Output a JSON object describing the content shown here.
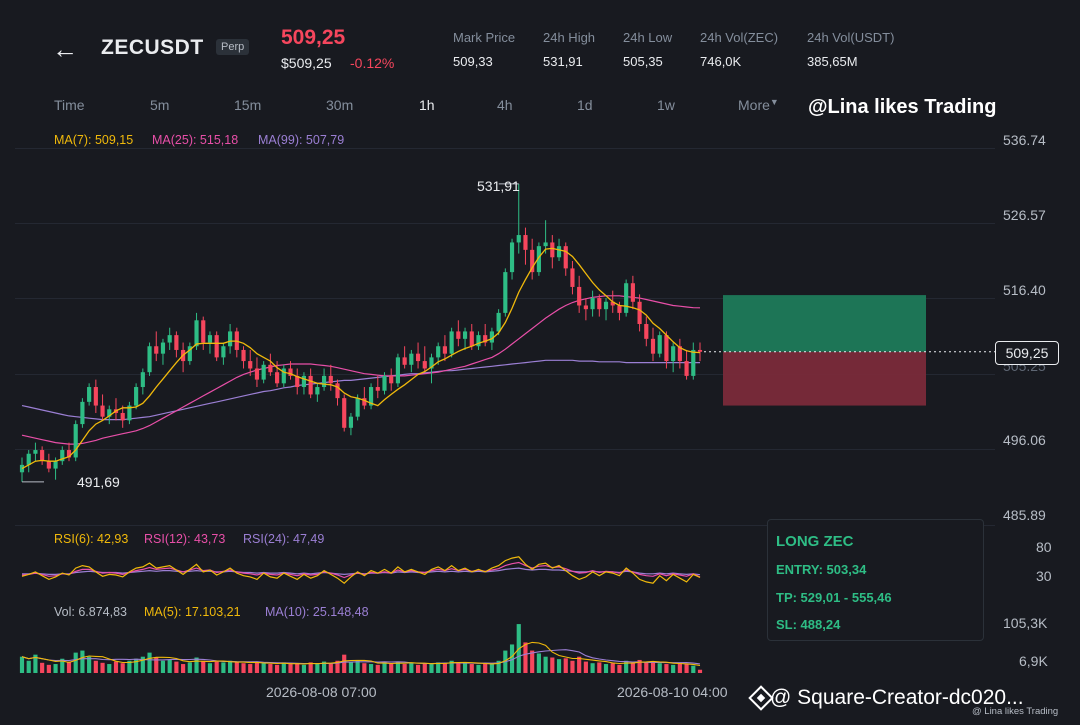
{
  "header": {
    "back_icon": "arrow-left-icon",
    "symbol": "ZECUSDT",
    "badge": "Perp",
    "last_price": "509,25",
    "last_price_usd": "$509,25",
    "change_pct": "-0.12%",
    "stats": [
      {
        "label": "Mark Price",
        "value": "509,33"
      },
      {
        "label": "24h High",
        "value": "531,91"
      },
      {
        "label": "24h Low",
        "value": "505,35"
      },
      {
        "label": "24h Vol(ZEC)",
        "value": "746,0K"
      },
      {
        "label": "24h Vol(USDT)",
        "value": "385,65M"
      }
    ]
  },
  "timeframes": [
    "Time",
    "5m",
    "15m",
    "30m",
    "1h",
    "4h",
    "1d",
    "1w",
    "More"
  ],
  "active_timeframe": "1h",
  "watermark": "@Lina likes Trading",
  "ma_legend": {
    "ma7": "MA(7): 509,15",
    "ma25": "MA(25): 515,18",
    "ma99": "MA(99): 507,79"
  },
  "rsi_legend": {
    "rsi6": "RSI(6): 42,93",
    "rsi12": "RSI(12): 43,73",
    "rsi24": "RSI(24): 47,49"
  },
  "vol_legend": {
    "vol": "Vol: 6.874,83",
    "ma5": "MA(5): 17.103,21",
    "ma10": "MA(10): 25.148,48"
  },
  "colors": {
    "up": "#2ebd85",
    "down": "#f6465d",
    "ma7": "#f0b90b",
    "ma25": "#e84fa8",
    "ma99": "#9b7fd4",
    "bg": "#181a20"
  },
  "signal": {
    "title": "LONG ZEC",
    "entry": "ENTRY: 503,34",
    "tp": "TP: 529,01 - 555,46",
    "sl": "SL: 488,24"
  },
  "footer": {
    "tag": "@ Square-Creator-dc020...",
    "small": "@ Lina likes Trading",
    "logo_icon": "binance-diamond-icon"
  },
  "chart_data": {
    "type": "candlestick",
    "y_ticks": [
      "536.74",
      "526.57",
      "516.40",
      "505.25",
      "496.06",
      "485.89"
    ],
    "ylim": [
      485.89,
      536.74
    ],
    "current_price_tag": "509,25",
    "high_label": "531,91",
    "low_label": "491,69",
    "x_labels": [
      "2026-08-08 07:00",
      "2026-08-10 04:00"
    ],
    "rsi_ticks": [
      "80",
      "30"
    ],
    "vol_ticks": [
      "105,3K",
      "6,9K"
    ],
    "candles": [
      [
        493.0,
        495.0,
        491.7,
        494.0
      ],
      [
        494.0,
        496.0,
        493.0,
        495.5
      ],
      [
        495.5,
        497.0,
        494.5,
        496.0
      ],
      [
        496.0,
        496.5,
        494.0,
        494.5
      ],
      [
        494.5,
        495.5,
        493.0,
        493.5
      ],
      [
        493.5,
        495.0,
        492.0,
        494.5
      ],
      [
        494.5,
        496.5,
        494.0,
        496.0
      ],
      [
        496.0,
        497.0,
        494.5,
        495.0
      ],
      [
        495.0,
        500.0,
        494.5,
        499.5
      ],
      [
        499.5,
        503.0,
        499.0,
        502.5
      ],
      [
        502.5,
        505.0,
        502.0,
        504.5
      ],
      [
        504.5,
        505.5,
        501.0,
        502.0
      ],
      [
        502.0,
        503.5,
        500.0,
        500.5
      ],
      [
        500.5,
        502.0,
        499.5,
        501.5
      ],
      [
        501.5,
        503.0,
        500.0,
        501.0
      ],
      [
        501.0,
        502.0,
        499.0,
        500.0
      ],
      [
        500.0,
        502.5,
        499.5,
        502.0
      ],
      [
        502.0,
        505.0,
        501.5,
        504.5
      ],
      [
        504.5,
        507.0,
        503.5,
        506.5
      ],
      [
        506.5,
        510.5,
        506.0,
        510.0
      ],
      [
        510.0,
        512.0,
        508.0,
        509.0
      ],
      [
        509.0,
        511.0,
        507.5,
        510.5
      ],
      [
        510.5,
        512.5,
        509.5,
        511.5
      ],
      [
        511.5,
        512.0,
        508.5,
        509.5
      ],
      [
        509.5,
        510.5,
        506.5,
        508.0
      ],
      [
        508.0,
        510.5,
        507.5,
        510.0
      ],
      [
        510.0,
        514.5,
        509.5,
        513.5
      ],
      [
        513.5,
        514.0,
        509.5,
        510.5
      ],
      [
        510.5,
        512.0,
        509.0,
        511.5
      ],
      [
        511.5,
        512.0,
        508.0,
        508.5
      ],
      [
        508.5,
        510.5,
        507.5,
        510.0
      ],
      [
        510.0,
        513.0,
        509.0,
        512.0
      ],
      [
        512.0,
        512.5,
        508.5,
        509.5
      ],
      [
        509.5,
        510.0,
        507.0,
        508.0
      ],
      [
        508.0,
        509.5,
        506.0,
        507.0
      ],
      [
        507.0,
        508.5,
        504.5,
        505.5
      ],
      [
        505.5,
        508.0,
        505.0,
        507.5
      ],
      [
        507.5,
        509.0,
        506.0,
        506.5
      ],
      [
        506.5,
        508.0,
        504.5,
        505.0
      ],
      [
        505.0,
        507.5,
        504.5,
        507.0
      ],
      [
        507.0,
        508.0,
        505.5,
        506.0
      ],
      [
        506.0,
        507.0,
        503.5,
        504.5
      ],
      [
        504.5,
        506.5,
        503.5,
        506.0
      ],
      [
        506.0,
        507.0,
        503.0,
        503.5
      ],
      [
        503.5,
        505.0,
        502.5,
        504.5
      ],
      [
        504.5,
        507.0,
        504.0,
        506.0
      ],
      [
        506.0,
        507.5,
        504.0,
        505.0
      ],
      [
        505.0,
        505.5,
        502.0,
        503.0
      ],
      [
        503.0,
        503.5,
        498.5,
        499.0
      ],
      [
        499.0,
        501.0,
        498.0,
        500.5
      ],
      [
        500.5,
        503.5,
        500.0,
        503.0
      ],
      [
        503.0,
        504.5,
        501.5,
        502.0
      ],
      [
        502.0,
        505.0,
        501.5,
        504.5
      ],
      [
        504.5,
        506.0,
        503.0,
        504.0
      ],
      [
        504.0,
        506.5,
        503.5,
        506.0
      ],
      [
        506.0,
        507.0,
        504.0,
        505.0
      ],
      [
        505.0,
        509.0,
        504.5,
        508.5
      ],
      [
        508.5,
        510.0,
        507.0,
        507.5
      ],
      [
        507.5,
        509.5,
        506.5,
        509.0
      ],
      [
        509.0,
        510.5,
        507.0,
        508.0
      ],
      [
        508.0,
        510.0,
        506.5,
        507.0
      ],
      [
        507.0,
        509.0,
        505.0,
        508.5
      ],
      [
        508.5,
        510.5,
        507.5,
        510.0
      ],
      [
        510.0,
        511.5,
        508.0,
        509.0
      ],
      [
        509.0,
        512.5,
        508.5,
        512.0
      ],
      [
        512.0,
        513.5,
        510.0,
        511.0
      ],
      [
        511.0,
        512.5,
        509.5,
        512.0
      ],
      [
        512.0,
        513.0,
        509.5,
        510.0
      ],
      [
        510.0,
        512.0,
        509.5,
        511.5
      ],
      [
        511.5,
        513.0,
        510.0,
        510.5
      ],
      [
        510.5,
        512.5,
        509.5,
        512.0
      ],
      [
        512.0,
        515.0,
        511.5,
        514.5
      ],
      [
        514.5,
        520.5,
        514.0,
        520.0
      ],
      [
        520.0,
        524.5,
        519.0,
        524.0
      ],
      [
        524.0,
        531.9,
        522.5,
        525.0
      ],
      [
        525.0,
        526.0,
        521.0,
        523.0
      ],
      [
        523.0,
        524.5,
        519.0,
        520.0
      ],
      [
        520.0,
        524.0,
        519.5,
        523.5
      ],
      [
        523.5,
        527.0,
        522.5,
        524.0
      ],
      [
        524.0,
        525.0,
        520.5,
        522.0
      ],
      [
        522.0,
        524.5,
        521.5,
        523.5
      ],
      [
        523.5,
        524.0,
        519.5,
        520.5
      ],
      [
        520.5,
        521.5,
        517.0,
        518.0
      ],
      [
        518.0,
        519.5,
        514.5,
        515.5
      ],
      [
        515.5,
        516.5,
        513.5,
        515.0
      ],
      [
        515.0,
        517.5,
        514.0,
        516.5
      ],
      [
        516.5,
        517.0,
        514.0,
        515.0
      ],
      [
        515.0,
        516.5,
        513.5,
        516.0
      ],
      [
        516.0,
        517.5,
        514.5,
        515.5
      ],
      [
        515.5,
        516.0,
        513.5,
        514.5
      ],
      [
        514.5,
        519.0,
        514.0,
        518.5
      ],
      [
        518.5,
        519.5,
        515.0,
        516.0
      ],
      [
        516.0,
        517.0,
        512.0,
        513.0
      ],
      [
        513.0,
        514.0,
        510.0,
        511.0
      ],
      [
        511.0,
        512.5,
        508.0,
        509.0
      ],
      [
        509.0,
        512.0,
        508.5,
        511.5
      ],
      [
        511.5,
        512.0,
        507.0,
        508.0
      ],
      [
        508.0,
        510.5,
        506.5,
        510.0
      ],
      [
        510.0,
        511.0,
        507.0,
        508.0
      ],
      [
        508.0,
        509.5,
        505.5,
        506.0
      ],
      [
        506.0,
        510.5,
        505.5,
        509.5
      ],
      [
        509.5,
        510.5,
        508.0,
        509.25
      ]
    ],
    "ma7": [
      493.5,
      494.0,
      494.5,
      494.6,
      494.5,
      494.5,
      494.8,
      495.1,
      496.0,
      497.3,
      498.6,
      499.5,
      500.0,
      500.6,
      501.3,
      501.7,
      501.7,
      501.8,
      502.3,
      503.3,
      504.5,
      505.6,
      506.7,
      507.8,
      508.8,
      509.5,
      510.3,
      510.4,
      510.4,
      510.4,
      510.4,
      510.7,
      510.7,
      510.4,
      509.8,
      509.0,
      508.5,
      508.0,
      507.1,
      506.5,
      506.3,
      505.9,
      505.6,
      505.3,
      505.0,
      504.9,
      504.8,
      504.5,
      503.7,
      503.2,
      503.0,
      502.7,
      502.3,
      502.0,
      502.8,
      503.5,
      504.2,
      504.8,
      505.5,
      506.2,
      506.6,
      507.2,
      507.9,
      508.3,
      508.8,
      509.3,
      509.7,
      510.0,
      510.4,
      510.7,
      511.0,
      511.8,
      513.2,
      515.1,
      517.3,
      519.0,
      520.6,
      522.0,
      523.1,
      523.2,
      523.0,
      522.8,
      522.1,
      521.0,
      519.8,
      518.6,
      517.6,
      516.8,
      516.0,
      515.5,
      515.4,
      515.2,
      514.9,
      514.2,
      513.1,
      512.4,
      511.5,
      510.6,
      509.8,
      509.4,
      509.2,
      509.15
    ],
    "ma25": [
      498.0,
      497.8,
      497.6,
      497.4,
      497.2,
      497.0,
      496.9,
      496.8,
      496.8,
      496.9,
      497.1,
      497.3,
      497.6,
      497.8,
      498.0,
      498.2,
      498.4,
      498.6,
      498.9,
      499.3,
      499.8,
      500.3,
      500.8,
      501.3,
      501.8,
      502.3,
      502.8,
      503.3,
      503.8,
      504.3,
      504.8,
      505.3,
      505.8,
      506.2,
      506.5,
      506.8,
      507.0,
      507.2,
      507.4,
      507.5,
      507.6,
      507.6,
      507.6,
      507.6,
      507.5,
      507.4,
      507.3,
      507.1,
      506.9,
      506.7,
      506.5,
      506.3,
      506.2,
      506.1,
      506.0,
      506.0,
      506.0,
      506.0,
      506.1,
      506.2,
      506.3,
      506.4,
      506.5,
      506.7,
      506.9,
      507.1,
      507.3,
      507.6,
      507.9,
      508.2,
      508.5,
      509.0,
      509.6,
      510.3,
      511.0,
      511.7,
      512.4,
      513.1,
      513.8,
      514.4,
      515.0,
      515.5,
      515.9,
      516.2,
      516.4,
      516.6,
      516.7,
      516.8,
      516.8,
      516.8,
      516.7,
      516.6,
      516.5,
      516.3,
      516.1,
      515.9,
      515.7,
      515.5,
      515.4,
      515.3,
      515.2,
      515.18
    ],
    "ma99": [
      502.0,
      501.8,
      501.6,
      501.4,
      501.2,
      501.0,
      500.8,
      500.6,
      500.5,
      500.4,
      500.3,
      500.2,
      500.1,
      500.1,
      500.1,
      500.1,
      500.2,
      500.3,
      500.4,
      500.5,
      500.7,
      500.9,
      501.1,
      501.3,
      501.5,
      501.7,
      501.9,
      502.1,
      502.3,
      502.5,
      502.7,
      502.9,
      503.1,
      503.3,
      503.5,
      503.7,
      503.9,
      504.0,
      504.2,
      504.4,
      504.5,
      504.7,
      504.8,
      504.9,
      505.0,
      505.1,
      505.2,
      505.3,
      505.4,
      505.4,
      505.5,
      505.6,
      505.7,
      505.8,
      505.9,
      506.0,
      506.1,
      506.2,
      506.3,
      506.3,
      506.4,
      506.5,
      506.6,
      506.7,
      506.7,
      506.8,
      506.9,
      507.0,
      507.1,
      507.2,
      507.3,
      507.4,
      507.5,
      507.6,
      507.7,
      507.8,
      507.9,
      508.0,
      508.1,
      508.1,
      508.1,
      508.1,
      508.1,
      508.0,
      508.0,
      508.0,
      507.9,
      507.9,
      507.9,
      507.9,
      507.8,
      507.8,
      507.8,
      507.8,
      507.8,
      507.8,
      507.8,
      507.8,
      507.8,
      507.8,
      507.8,
      507.79
    ],
    "rsi6": [
      45,
      48,
      52,
      46,
      40,
      44,
      50,
      47,
      58,
      62,
      60,
      52,
      45,
      48,
      47,
      44,
      52,
      58,
      60,
      66,
      58,
      60,
      62,
      55,
      48,
      56,
      64,
      52,
      55,
      47,
      52,
      58,
      50,
      46,
      44,
      40,
      50,
      44,
      42,
      50,
      45,
      40,
      48,
      42,
      46,
      54,
      48,
      42,
      34,
      44,
      52,
      46,
      54,
      50,
      56,
      50,
      60,
      52,
      56,
      52,
      48,
      56,
      60,
      54,
      62,
      54,
      58,
      52,
      56,
      52,
      58,
      62,
      70,
      74,
      76,
      64,
      56,
      64,
      66,
      58,
      62,
      54,
      46,
      40,
      44,
      52,
      46,
      52,
      50,
      46,
      58,
      50,
      40,
      36,
      34,
      46,
      38,
      48,
      42,
      36,
      48,
      43
    ],
    "rsi12": [
      47,
      48,
      50,
      48,
      45,
      46,
      49,
      48,
      53,
      56,
      56,
      53,
      50,
      51,
      50,
      48,
      51,
      54,
      56,
      59,
      56,
      57,
      58,
      55,
      52,
      55,
      58,
      54,
      55,
      51,
      53,
      55,
      52,
      50,
      49,
      47,
      50,
      48,
      47,
      50,
      48,
      46,
      49,
      47,
      48,
      52,
      50,
      47,
      43,
      47,
      50,
      48,
      51,
      50,
      52,
      50,
      55,
      52,
      54,
      52,
      51,
      54,
      56,
      54,
      57,
      54,
      56,
      53,
      55,
      53,
      55,
      57,
      62,
      65,
      67,
      62,
      58,
      61,
      62,
      59,
      60,
      57,
      53,
      50,
      51,
      54,
      51,
      53,
      52,
      50,
      55,
      52,
      48,
      46,
      45,
      49,
      46,
      49,
      47,
      45,
      49,
      43.73
    ],
    "rsi24": [
      49,
      49,
      50,
      49,
      48,
      48,
      49,
      49,
      51,
      52,
      53,
      52,
      51,
      51,
      51,
      50,
      51,
      52,
      53,
      54,
      53,
      54,
      54,
      53,
      52,
      53,
      54,
      53,
      53,
      52,
      52,
      53,
      52,
      51,
      51,
      50,
      51,
      50,
      50,
      51,
      50,
      49,
      50,
      49,
      50,
      51,
      50,
      49,
      48,
      49,
      50,
      49,
      50,
      50,
      51,
      50,
      52,
      51,
      52,
      51,
      51,
      52,
      53,
      52,
      53,
      52,
      53,
      52,
      53,
      52,
      53,
      54,
      56,
      57,
      58,
      56,
      55,
      56,
      56,
      55,
      55,
      54,
      53,
      52,
      52,
      53,
      52,
      52,
      52,
      51,
      53,
      52,
      50,
      49,
      49,
      50,
      49,
      50,
      49,
      48,
      49,
      47.49
    ],
    "volume": [
      40,
      30,
      45,
      25,
      20,
      22,
      35,
      28,
      50,
      55,
      40,
      30,
      25,
      22,
      28,
      24,
      30,
      35,
      40,
      50,
      38,
      30,
      32,
      28,
      22,
      26,
      38,
      30,
      24,
      28,
      26,
      30,
      26,
      24,
      22,
      28,
      24,
      22,
      20,
      26,
      22,
      24,
      20,
      26,
      22,
      28,
      24,
      30,
      45,
      26,
      30,
      24,
      22,
      20,
      26,
      24,
      28,
      22,
      26,
      20,
      24,
      22,
      26,
      24,
      30,
      26,
      24,
      22,
      20,
      24,
      22,
      30,
      55,
      70,
      120,
      75,
      55,
      48,
      40,
      38,
      34,
      36,
      30,
      40,
      28,
      24,
      26,
      22,
      24,
      20,
      30,
      26,
      32,
      28,
      26,
      24,
      22,
      20,
      24,
      22,
      18,
      8
    ],
    "vol_max": 130
  }
}
